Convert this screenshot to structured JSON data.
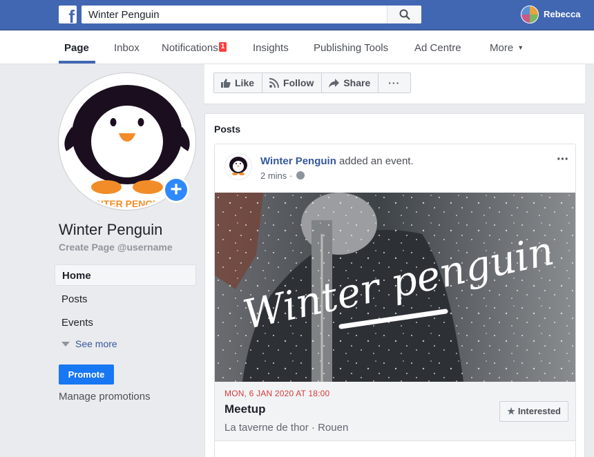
{
  "topbar": {
    "search_value": "Winter Penguin",
    "user_name": "Rebecca"
  },
  "page_nav": {
    "tabs": [
      {
        "label": "Page"
      },
      {
        "label": "Inbox"
      },
      {
        "label": "Notifications",
        "badge": "1"
      },
      {
        "label": "Insights"
      },
      {
        "label": "Publishing Tools"
      },
      {
        "label": "Ad Centre"
      },
      {
        "label": "More"
      }
    ]
  },
  "sidebar": {
    "page_name": "Winter Penguin",
    "create_username": "Create Page @username",
    "items": [
      {
        "label": "Home"
      },
      {
        "label": "Posts"
      },
      {
        "label": "Events"
      }
    ],
    "see_more": "See more",
    "promote_label": "Promote",
    "manage_promotions": "Manage promotions",
    "logo_partial_text": "WINTER PENGUIN"
  },
  "actions": {
    "like": "Like",
    "follow": "Follow",
    "share": "Share",
    "more": "···"
  },
  "posts": {
    "title": "Posts",
    "post": {
      "author": "Winter Penguin",
      "action_text": " added an event.",
      "time": "2 mins · ",
      "image_text": "Winter penguin",
      "event": {
        "date": "MON, 6 JAN 2020 AT 18:00",
        "title": "Meetup",
        "location": "La taverne de thor · Rouen",
        "interested_label": "Interested"
      }
    }
  },
  "colors": {
    "brand_blue": "#4267b2",
    "link_blue": "#365899",
    "promote_blue": "#1877f2",
    "event_red": "#d13b3b"
  }
}
